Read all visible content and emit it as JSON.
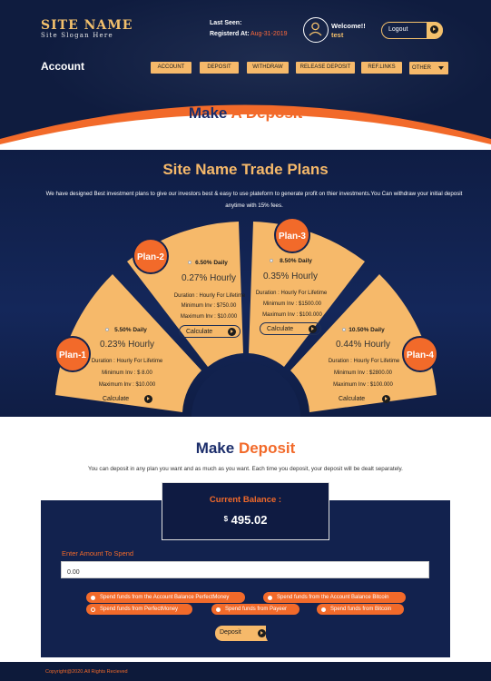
{
  "brand": {
    "name": "SITE NAME",
    "slogan": "Site Slogan Here"
  },
  "user": {
    "last_seen_label": "Last Seen:",
    "registered_label": "Registerd At:",
    "registered_date": "Aug-31-2019",
    "welcome": "Welcome!!",
    "username": "test",
    "logout_label": "Logout"
  },
  "nav": {
    "account_title": "Account",
    "items": [
      "ACCOUNT",
      "DEPOSIT",
      "WITHDRAW",
      "RELEASE DEPOSIT",
      "REF.LINKS"
    ],
    "other_label": "OTHER"
  },
  "page_title": {
    "main": "Make",
    "accent": "A Deposit"
  },
  "plans_section": {
    "title": "Site Name Trade Plans",
    "description": "We have designed Best investment plans to give our investors best & easy to use plateform to generate profit on thier investments.You Can withdraw your initial deposit anytime with 15% fees.",
    "calculate_label": "Calculate",
    "plans": [
      {
        "name": "Plan-1",
        "daily": "5.50% Daily",
        "hourly": "0.23% Hourly",
        "duration": "Duration : Hourly For Lifetime",
        "min": "Minimum Inv : $ 8.00",
        "max": "Maximum Inv : $10.000"
      },
      {
        "name": "Plan-2",
        "daily": "6.50% Daily",
        "hourly": "0.27% Hourly",
        "duration": "Duration : Hourly For Lifetime",
        "min": "Minimum Inv : $750.00",
        "max": "Maximum Inv : $10.000"
      },
      {
        "name": "Plan-3",
        "daily": "8.50% Daily",
        "hourly": "0.35% Hourly",
        "duration": "Duration : Hourly For Lifetime",
        "min": "Minimum Inv : $1500.00",
        "max": "Maximum Inv : $100.000"
      },
      {
        "name": "Plan-4",
        "daily": "10.50% Daily",
        "hourly": "0.44% Hourly",
        "duration": "Duration : Hourly For Lifetime",
        "min": "Minimum Inv : $2800.00",
        "max": "Maximum Inv : $100.000"
      }
    ]
  },
  "deposit_section": {
    "title_main": "Make",
    "title_accent": "Deposit",
    "description": "You can deposit in any plan you want and as much as you want. Each time you deposit, your deposit will be dealt separately.",
    "balance_label": "Current Balance :",
    "balance_currency": "$",
    "balance_value": "495.02",
    "amount_label": "Enter Amount To Spend",
    "amount_value": "0.00",
    "options": [
      "Spend funds from the Account Balance PerfectMoney",
      "Spend funds from the Account Balance Bitcoin",
      "Spend funds from PerfectMoney",
      "Spend funds from Payeer",
      "Spend funds from Bitcoin"
    ],
    "deposit_button": "Deposit"
  },
  "footer": {
    "copyright": "Copyright@2020.All Rights Recieved"
  },
  "colors": {
    "navy": "#12224e",
    "orange": "#f26a2a",
    "gold": "#f6b96a"
  }
}
